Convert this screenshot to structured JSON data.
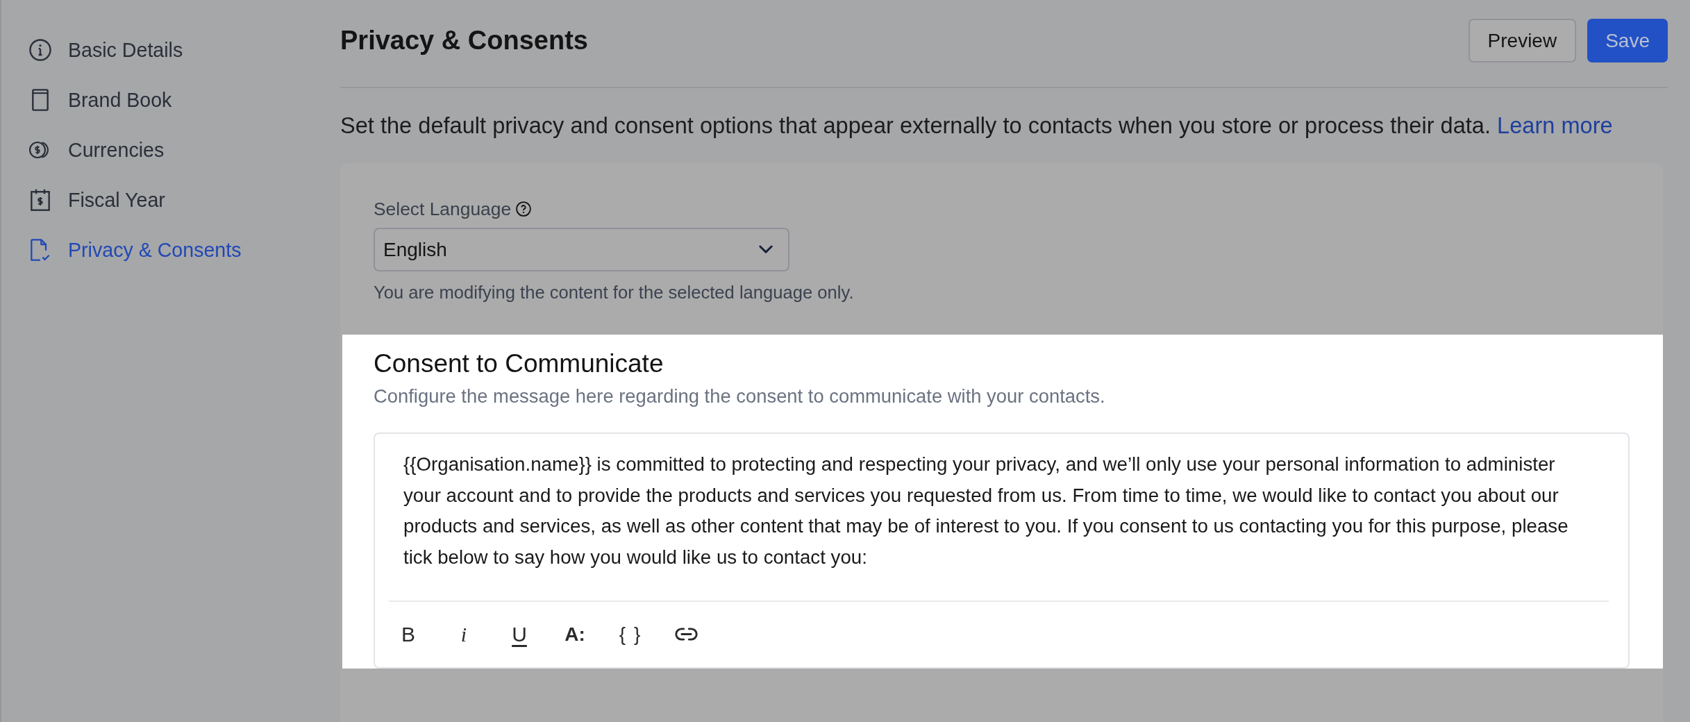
{
  "sidebar": {
    "items": [
      {
        "label": "Basic Details",
        "selected": false
      },
      {
        "label": "Brand Book",
        "selected": false
      },
      {
        "label": "Currencies",
        "selected": false
      },
      {
        "label": "Fiscal Year",
        "selected": false
      },
      {
        "label": "Privacy & Consents",
        "selected": true
      }
    ]
  },
  "header": {
    "title": "Privacy & Consents",
    "buttons": [
      {
        "label": "Preview",
        "kind": "secondary"
      },
      {
        "label": "Save",
        "kind": "primary"
      }
    ]
  },
  "intro": {
    "text": "Set the default privacy and consent options that appear externally to contacts when you store or process their data.",
    "link": "Learn more"
  },
  "language": {
    "label": "Select Language",
    "value": "English",
    "hint": "You are modifying the content for the selected language only."
  },
  "consent_to_communicate": {
    "title": "Consent to Communicate",
    "subtitle": "Configure the message here regarding the consent to communicate with your contacts.",
    "message": "{{Organisation.name}} is committed to protecting and respecting your privacy, and we’ll only use your personal information to administer your account and to provide the products and services you requested from us. From time to time, we would like to contact you about our products and services, as well as other content that may be of interest to you. If you consent to us contacting you for this purpose, please tick below to say how you would like us to contact you:",
    "toolbar": [
      {
        "kind": "bold",
        "label": "B"
      },
      {
        "kind": "italic",
        "label": "i"
      },
      {
        "kind": "underline",
        "label": "U"
      },
      {
        "kind": "font_size",
        "label": "A:"
      },
      {
        "kind": "variable",
        "label": "{ }"
      },
      {
        "kind": "link"
      }
    ]
  }
}
